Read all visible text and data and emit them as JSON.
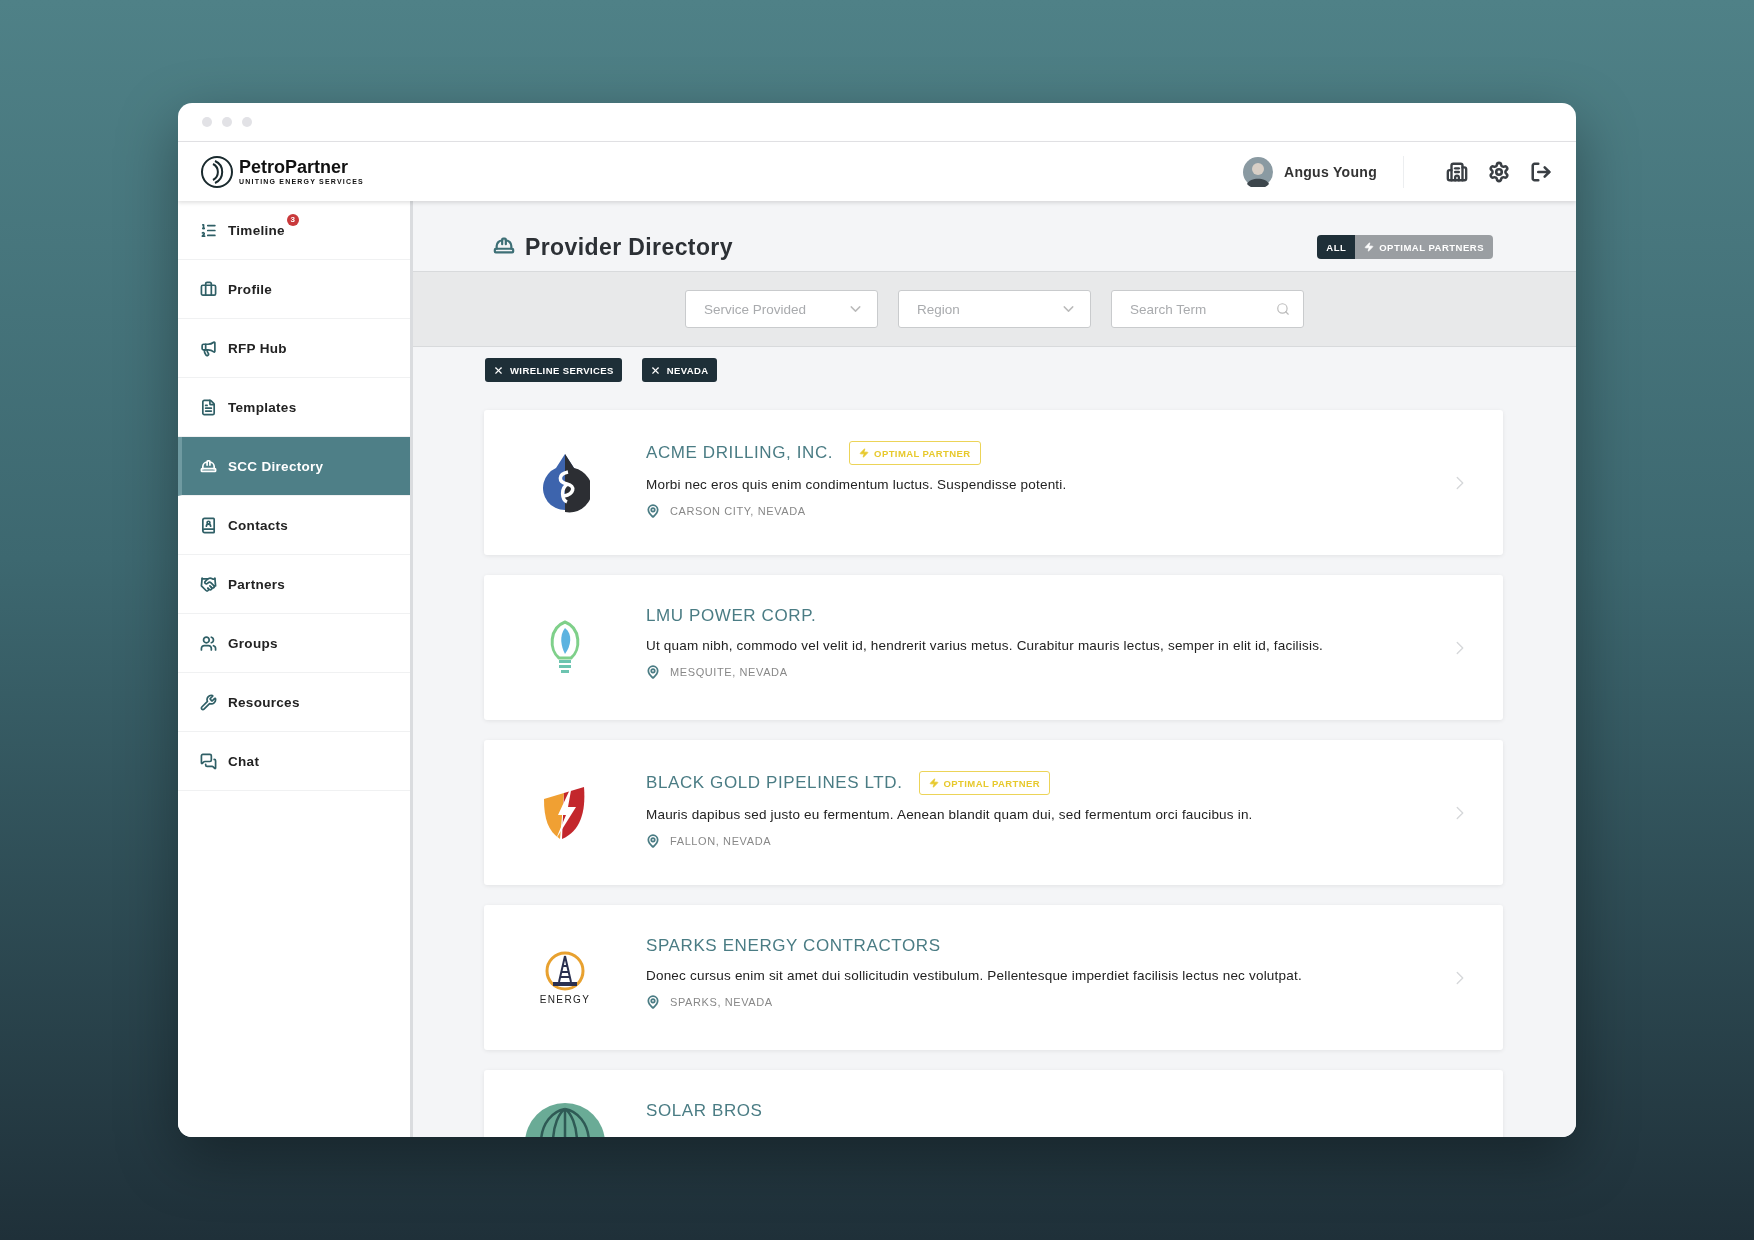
{
  "logo": {
    "name": "PetroPartner",
    "tagline": "UNITING ENERGY SERVICES"
  },
  "user": {
    "name": "Angus Young"
  },
  "sidebar": {
    "items": [
      {
        "label": "Timeline",
        "badge": "3",
        "selected": false
      },
      {
        "label": "Profile",
        "selected": false
      },
      {
        "label": "RFP Hub",
        "selected": false
      },
      {
        "label": "Templates",
        "selected": false
      },
      {
        "label": "SCC Directory",
        "selected": true
      },
      {
        "label": "Contacts",
        "selected": false
      },
      {
        "label": "Partners",
        "selected": false
      },
      {
        "label": "Groups",
        "selected": false
      },
      {
        "label": "Resources",
        "selected": false
      },
      {
        "label": "Chat",
        "selected": false
      }
    ]
  },
  "page": {
    "title": "Provider Directory"
  },
  "view_toggle": [
    {
      "label": "ALL",
      "selected": true,
      "kind": "all"
    },
    {
      "label": "OPTIMAL PARTNERS",
      "selected": false,
      "kind": "optimal"
    }
  ],
  "filters": [
    {
      "kind": "select",
      "placeholder": "Service Provided"
    },
    {
      "kind": "select",
      "placeholder": "Region"
    },
    {
      "kind": "search",
      "placeholder": "Search Term"
    }
  ],
  "active_filters": [
    {
      "label": "WIRELINE SERVICES"
    },
    {
      "label": "NEVADA"
    }
  ],
  "providers": [
    {
      "name": "ACME DRILLING, INC.",
      "badge": "OPTIMAL PARTNER",
      "description": "Morbi nec eros quis enim condimentum luctus. Suspendisse potenti.",
      "location": "CARSON CITY, NEVADA"
    },
    {
      "name": "LMU POWER CORP.",
      "description": "Ut quam nibh, commodo vel velit id, hendrerit varius metus. Curabitur mauris lectus, semper in elit id, facilisis.",
      "location": "MESQUITE, NEVADA"
    },
    {
      "name": "BLACK GOLD PIPELINES LTD.",
      "badge": "OPTIMAL PARTNER",
      "description": "Mauris dapibus sed justo eu fermentum. Aenean blandit quam dui, sed fermentum orci faucibus in.",
      "location": "FALLON, NEVADA"
    },
    {
      "name": "SPARKS ENERGY CONTRACTORS",
      "logo_text": "ENERGY",
      "description": "Donec cursus enim sit amet dui sollicitudin vestibulum. Pellentesque imperdiet facilisis lectus nec volutpat.",
      "location": "SPARKS, NEVADA"
    },
    {
      "name": "SOLAR BROS"
    }
  ]
}
